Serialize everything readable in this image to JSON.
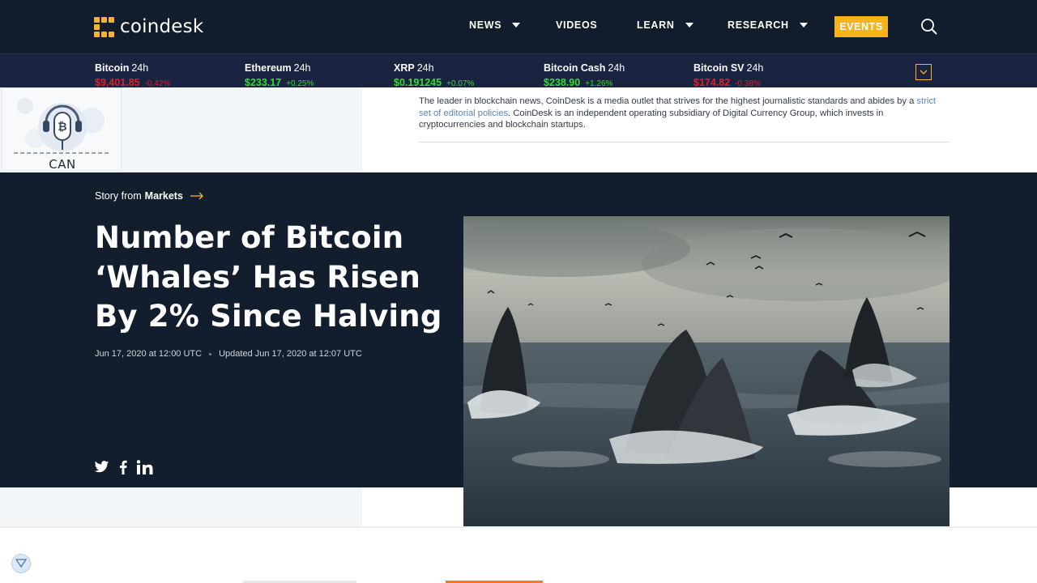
{
  "brand": {
    "name": "coindesk",
    "logo_color": "#f6b42a"
  },
  "nav": {
    "items": [
      {
        "label": "NEWS",
        "has_dropdown": true
      },
      {
        "label": "VIDEOS",
        "has_dropdown": false
      },
      {
        "label": "LEARN",
        "has_dropdown": true
      },
      {
        "label": "RESEARCH",
        "has_dropdown": true
      }
    ],
    "events_label": "EVENTS",
    "events_color": "#f7b31b",
    "search_icon": "search-icon"
  },
  "ticker": {
    "items": [
      {
        "name": "Bitcoin",
        "period": "24h",
        "price": "$9,401.85",
        "change": "-0.42%",
        "direction": "down"
      },
      {
        "name": "Ethereum",
        "period": "24h",
        "price": "$233.17",
        "change": "+0.25%",
        "direction": "up"
      },
      {
        "name": "XRP",
        "period": "24h",
        "price": "$0.191245",
        "change": "+0.07%",
        "direction": "up"
      },
      {
        "name": "Bitcoin Cash",
        "period": "24h",
        "price": "$238.90",
        "change": "+1.26%",
        "direction": "up"
      },
      {
        "name": "Bitcoin SV",
        "period": "24h",
        "price": "$174.82",
        "change": "-0.38%",
        "direction": "down"
      }
    ],
    "toggle_icon": "chevron-down-icon"
  },
  "info": {
    "text_before": "The leader in blockchain news, CoinDesk is a media outlet that strives for the highest journalistic standards and abides by a ",
    "link_text": "strict set of editorial policies",
    "text_after": ". CoinDesk is an independent operating subsidiary of Digital Currency Group, which invests in cryptocurrencies and blockchain startups."
  },
  "podcast_widget": {
    "label": "CAN",
    "icon": "bitcoin-microphone-icon"
  },
  "article": {
    "story_from_prefix": "Story from",
    "section": "Markets",
    "headline": "Number of Bitcoin ‘Whales’ Has Risen By 2% Since Halving",
    "published": "Jun 17, 2020 at 12:00 UTC",
    "updated": "Updated Jun 17, 2020 at 12:07 UTC",
    "share_icons": [
      "twitter-icon",
      "facebook-icon",
      "linkedin-icon"
    ],
    "image_alt": "humpback-whales-breaching-image"
  },
  "bottom": {
    "button_icon": "filter-icon"
  }
}
